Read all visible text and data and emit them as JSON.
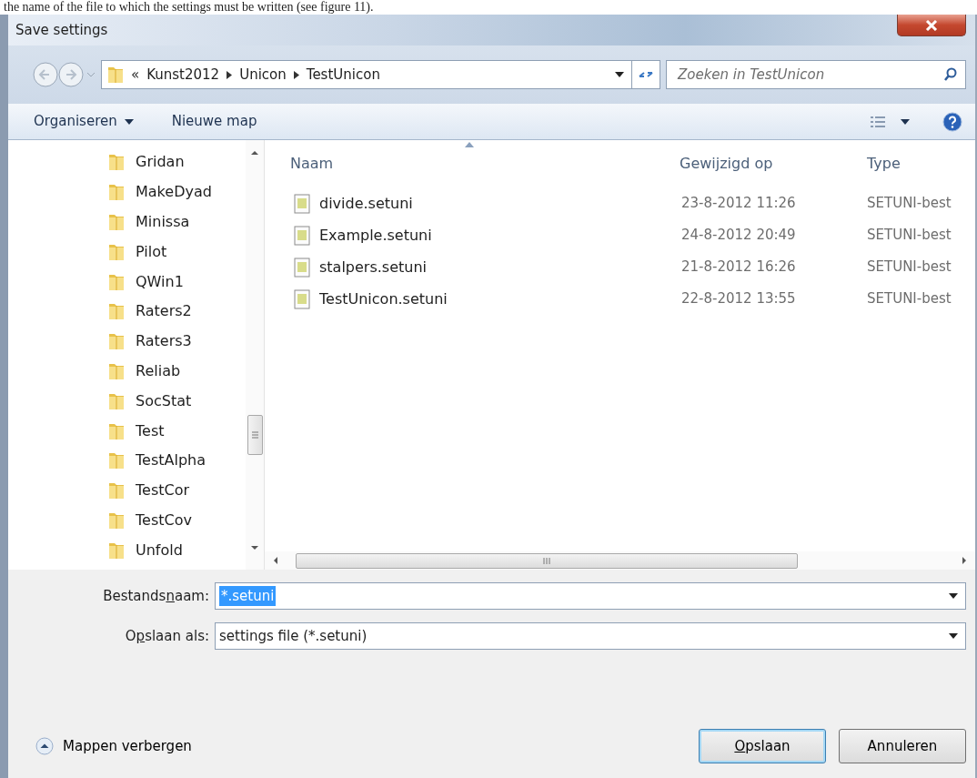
{
  "document_text": "the name of the file to which the settings must be written (see figure 11).",
  "window": {
    "title": "Save settings"
  },
  "address": {
    "overflow": "«",
    "crumbs": [
      "Kunst2012",
      "Unicon",
      "TestUnicon"
    ]
  },
  "search": {
    "placeholder": "Zoeken in TestUnicon"
  },
  "toolbar": {
    "organize": "Organiseren",
    "new_folder": "Nieuwe map"
  },
  "folders": [
    "Gridan",
    "MakeDyad",
    "Minissa",
    "Pilot",
    "QWin1",
    "Raters2",
    "Raters3",
    "Reliab",
    "SocStat",
    "Test",
    "TestAlpha",
    "TestCor",
    "TestCov",
    "Unfold"
  ],
  "columns": [
    "Naam",
    "Gewijzigd op",
    "Type"
  ],
  "files": [
    {
      "name": "divide.setuni",
      "modified": "23-8-2012 11:26",
      "type": "SETUNI-best"
    },
    {
      "name": "Example.setuni",
      "modified": "24-8-2012 20:49",
      "type": "SETUNI-best"
    },
    {
      "name": "stalpers.setuni",
      "modified": "21-8-2012 16:26",
      "type": "SETUNI-best"
    },
    {
      "name": "TestUnicon.setuni",
      "modified": "22-8-2012 13:55",
      "type": "SETUNI-best"
    }
  ],
  "filename": {
    "label": {
      "before": "Bestands",
      "key": "n",
      "after": "aam:"
    },
    "value": "*.setuni",
    "text_selected": true
  },
  "save_as": {
    "label": {
      "before": "O",
      "key": "p",
      "after": "slaan als:"
    },
    "value": "settings file (*.setuni)"
  },
  "hide_folders": "Mappen verbergen",
  "buttons": [
    {
      "key": "O",
      "after": "pslaan",
      "default": true
    },
    {
      "text": "Annuleren",
      "default": false
    }
  ]
}
